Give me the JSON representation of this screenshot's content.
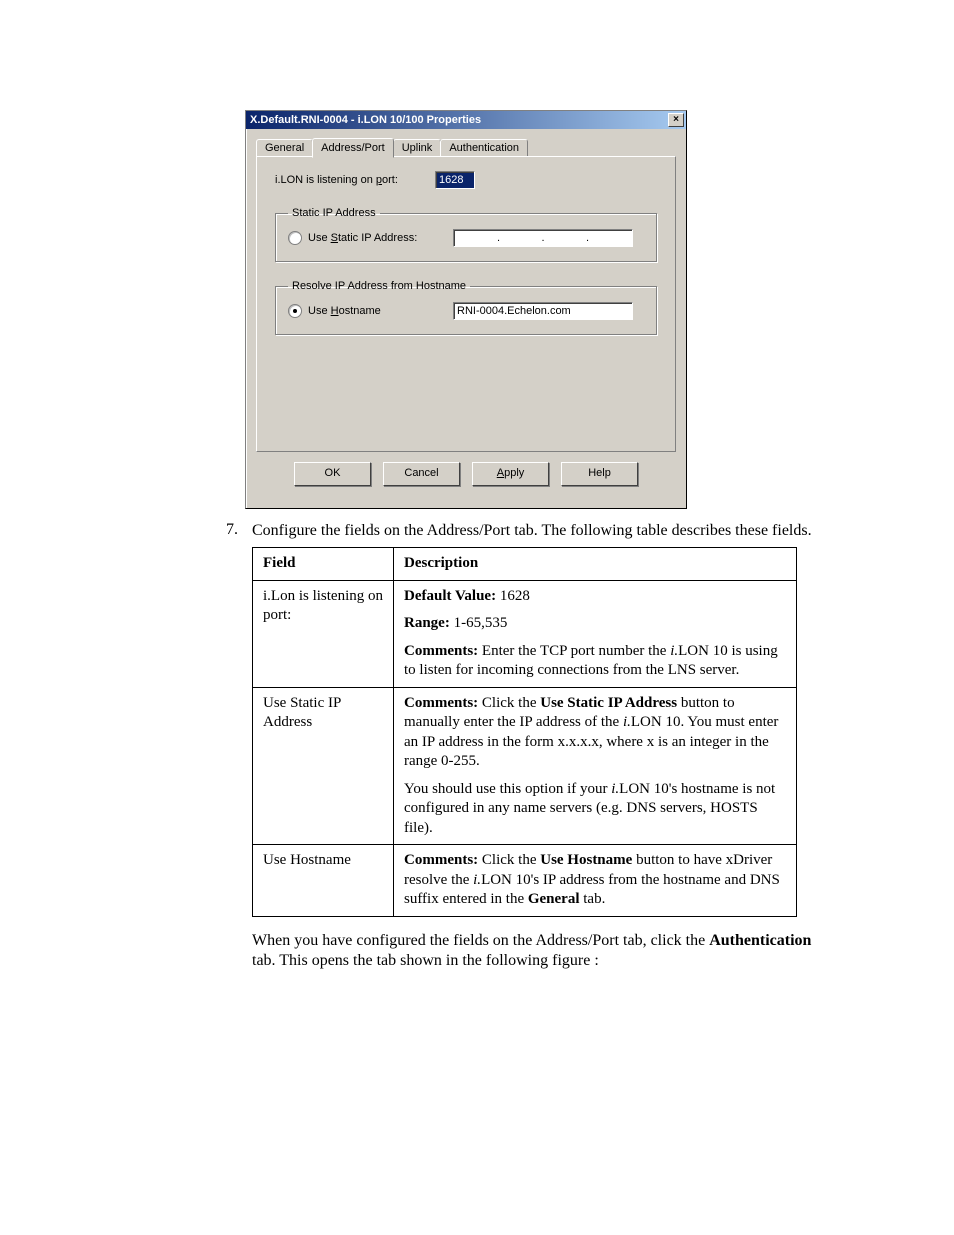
{
  "dialog": {
    "title": "X.Default.RNI-0004 - i.LON 10/100 Properties",
    "close": "×",
    "tabs": {
      "general": "General",
      "address_port": "Address/Port",
      "uplink": "Uplink",
      "authentication": "Authentication"
    },
    "port": {
      "label_pre": "i.LON is listening on ",
      "label_u": "p",
      "label_post": "ort:",
      "value": "1628"
    },
    "static_group": {
      "legend": "Static IP Address",
      "label_pre": "Use ",
      "label_u": "S",
      "label_post": "tatic IP Address:",
      "ip_dot": "."
    },
    "host_group": {
      "legend": "Resolve IP Address from Hostname",
      "label_pre": "Use ",
      "label_u": "H",
      "label_post": "ostname",
      "value": "RNI-0004.Echelon.com"
    },
    "buttons": {
      "ok": "OK",
      "cancel": "Cancel",
      "apply_u": "A",
      "apply_post": "pply",
      "help": "Help"
    }
  },
  "step": {
    "num": "7",
    "text": "Configure the fields on the Address/Port tab. The following table describes these fields."
  },
  "table": {
    "hdr_field": "Field",
    "hdr_desc": "Description",
    "rows": [
      {
        "field": "i.Lon is listening on port:",
        "dv_lab": "Default Value:",
        "dv_val": " 1628",
        "rng_lab": "Range:",
        "rng_val": " 1-65,535",
        "cm_lab": "Comments:",
        "cm_pre": " Enter the TCP port number the ",
        "cm_i": "i.",
        "cm_post": "LON 10 is using to listen for incoming connections from the LNS server."
      },
      {
        "field": "Use Static IP Address",
        "cm_lab": "Comments:",
        "cm_pre": " Click the ",
        "cm_b": "Use Static IP Address",
        "cm_mid": " button to manually enter the IP address of the ",
        "cm_i": "i.",
        "cm_post": "LON 10. You must enter an IP address in the form x.x.x.x, where x is an integer in the range 0-255.",
        "p2_pre": "You should use this option if your ",
        "p2_i": "i.",
        "p2_post": "LON 10's hostname is not configured in any name servers (e.g. DNS servers, HOSTS file)."
      },
      {
        "field": "Use Hostname",
        "cm_lab": "Comments:",
        "cm_pre": " Click the ",
        "cm_b": "Use Hostname",
        "cm_mid": " button to have xDriver resolve the ",
        "cm_i": "i.",
        "cm_post": "LON 10's IP address from the hostname and DNS suffix entered in the ",
        "cm_b2": "General",
        "cm_tail": " tab."
      }
    ]
  },
  "footer": {
    "pre": "When you have configured the fields on the Address/Port tab, click the ",
    "bold": "Authentication",
    "post": " tab. This opens the tab shown in the following figure :"
  }
}
